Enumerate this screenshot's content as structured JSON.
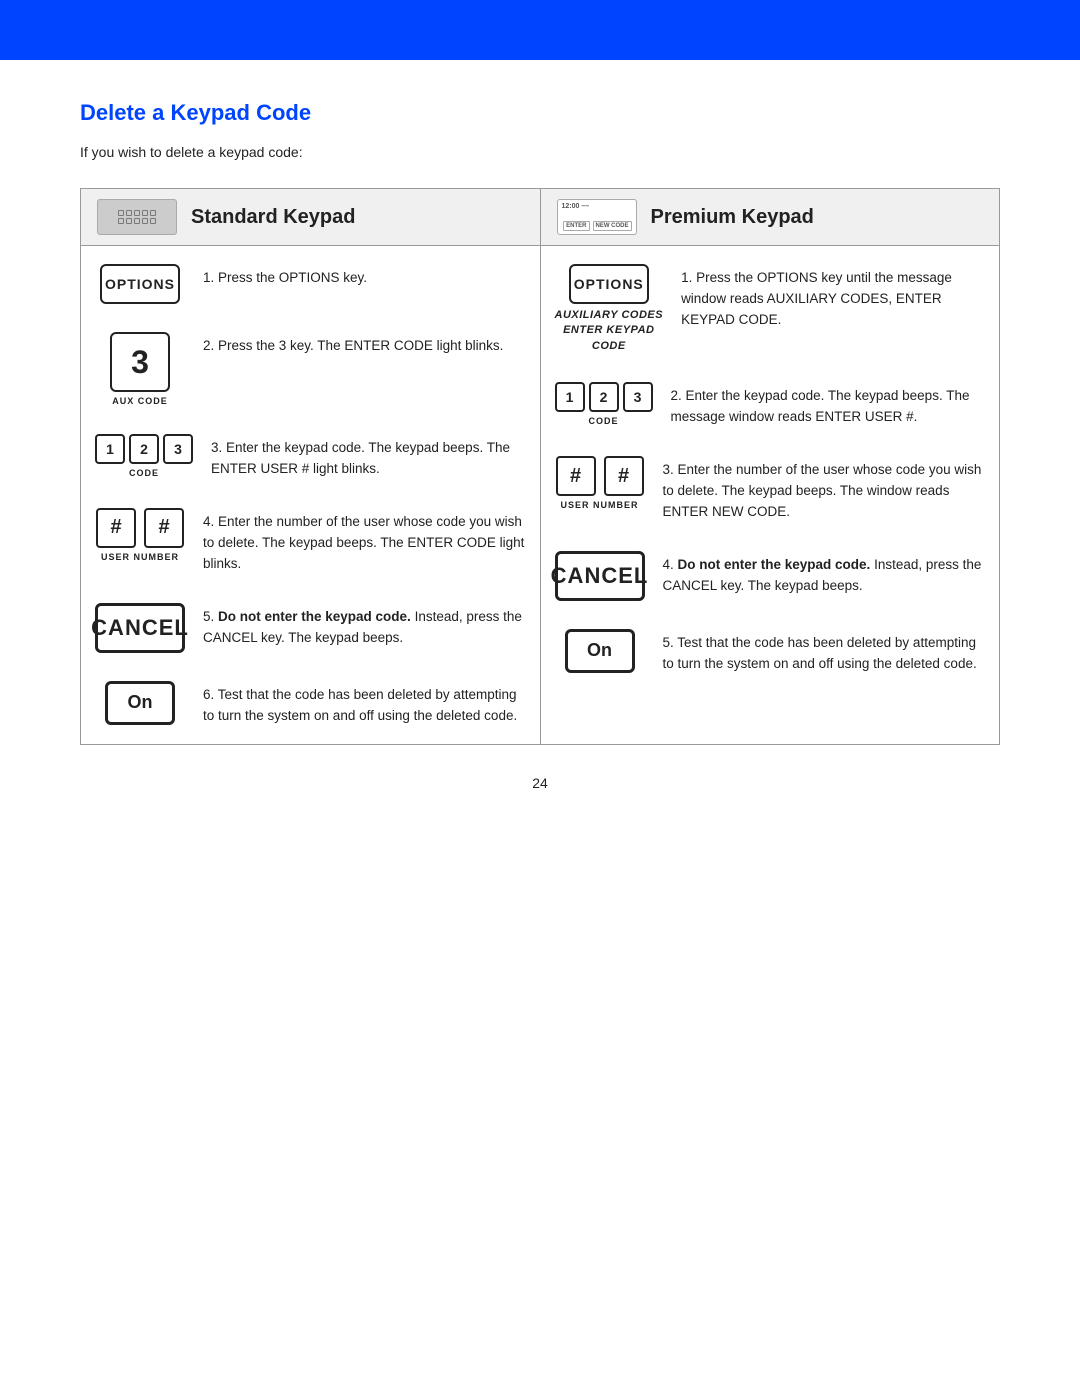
{
  "topBar": {
    "color": "#0044ff"
  },
  "pageTitle": "Delete a Keypad Code",
  "introText": "If you wish to delete a keypad code:",
  "standard": {
    "header": "Standard Keypad",
    "steps": [
      {
        "keyType": "options",
        "keyLabel": "",
        "text": "1. Press the OPTIONS key."
      },
      {
        "keyType": "3",
        "keyLabel": "AUX CODE",
        "text": "2. Press the 3 key. The ENTER CODE light blinks."
      },
      {
        "keyType": "123",
        "keyLabel": "CODE",
        "text": "3. Enter the keypad code. The keypad beeps. The ENTER USER # light blinks."
      },
      {
        "keyType": "##",
        "keyLabel": "USER NUMBER",
        "text": "4. Enter the number of the user whose code you wish to delete. The keypad beeps. The ENTER CODE light blinks."
      },
      {
        "keyType": "cancel",
        "keyLabel": "",
        "text": "5. Do not enter the keypad code. Instead, press the CANCEL key. The keypad beeps."
      },
      {
        "keyType": "on",
        "keyLabel": "",
        "text": "6. Test that the code has been deleted by attempting to turn the system on and off using the deleted code."
      }
    ]
  },
  "premium": {
    "header": "Premium Keypad",
    "steps": [
      {
        "keyType": "options-aux",
        "keyLabel": "",
        "auxText": "AUXILIARY CODES ENTER KEYPAD CODE",
        "text": "1. Press the OPTIONS key until the message window reads AUXILIARY CODES, ENTER KEYPAD CODE."
      },
      {
        "keyType": "123",
        "keyLabel": "CODE",
        "text": "2. Enter the keypad code. The keypad beeps. The message window reads ENTER USER #."
      },
      {
        "keyType": "##",
        "keyLabel": "USER NUMBER",
        "text": "3. Enter the number of the user whose code you wish to delete. The keypad beeps. The window reads ENTER NEW CODE."
      },
      {
        "keyType": "cancel",
        "keyLabel": "",
        "text": "4. Do not enter the keypad code. Instead, press the CANCEL key. The keypad beeps."
      },
      {
        "keyType": "on",
        "keyLabel": "",
        "text": "5. Test that the code has been deleted by attempting to turn the system on and off using the deleted code."
      }
    ]
  },
  "pageNumber": "24"
}
